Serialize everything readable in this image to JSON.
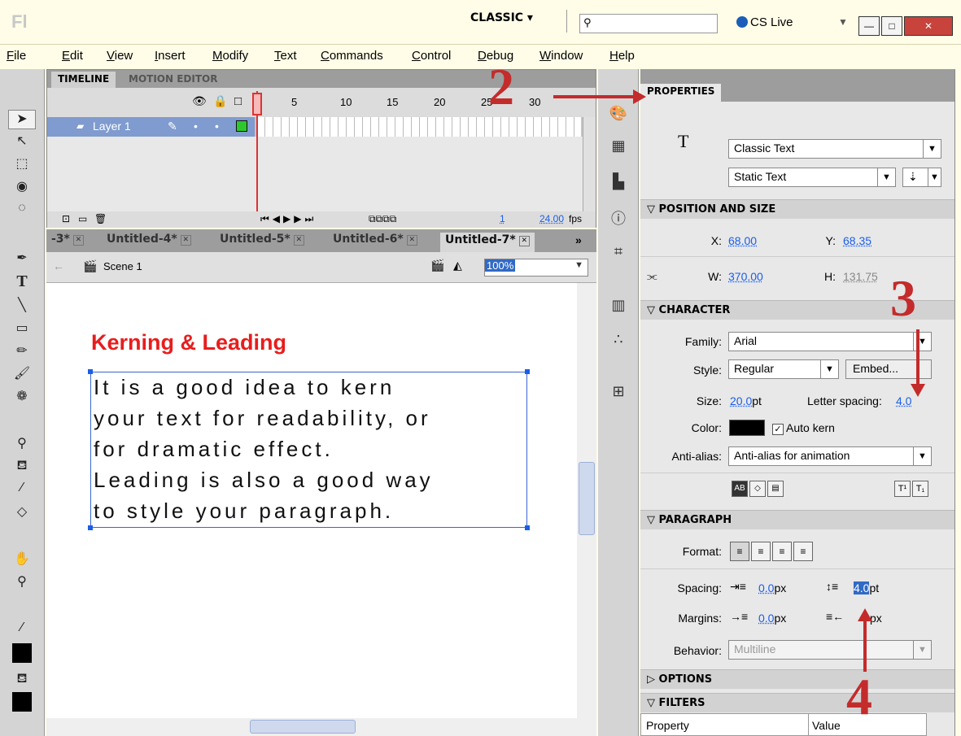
{
  "titlebar": {
    "app_logo": "Fl",
    "workspace": "CLASSIC",
    "search_icon": "search-icon",
    "cs_live": "CS Live"
  },
  "menu": [
    "File",
    "Edit",
    "View",
    "Insert",
    "Modify",
    "Text",
    "Commands",
    "Control",
    "Debug",
    "Window",
    "Help"
  ],
  "timeline": {
    "tabs": [
      "TIMELINE",
      "MOTION EDITOR"
    ],
    "frame_numbers": [
      "5",
      "10",
      "15",
      "20",
      "25",
      "30"
    ],
    "layer_name": "Layer 1",
    "current_frame": "1",
    "fps": "24.00",
    "fps_unit": "fps"
  },
  "doc_tabs": [
    "-3*",
    "Untitled-4*",
    "Untitled-5*",
    "Untitled-6*",
    "Untitled-7*"
  ],
  "scene": {
    "label": "Scene 1",
    "zoom": "100%"
  },
  "stage": {
    "title": "Kerning & Leading",
    "lines": [
      "It is a good idea to kern",
      "your text for readability, or",
      "for dramatic effect.",
      "Leading is also a good way",
      "to style your paragraph."
    ]
  },
  "properties": {
    "tab": "PROPERTIES",
    "text_type": "Classic Text",
    "text_kind": "Static Text",
    "position_section": "POSITION AND SIZE",
    "x_label": "X:",
    "x": "68.00",
    "y_label": "Y:",
    "y": "68.35",
    "w_label": "W:",
    "w": "370.00",
    "h_label": "H:",
    "h": "131.75",
    "character_section": "CHARACTER",
    "family_label": "Family:",
    "family": "Arial",
    "style_label": "Style:",
    "style": "Regular",
    "embed": "Embed...",
    "size_label": "Size:",
    "size": "20.0",
    "size_unit": "pt",
    "letter_spacing_label": "Letter spacing:",
    "letter_spacing": "4.0",
    "color_label": "Color:",
    "auto_kern": "Auto kern",
    "antialias_label": "Anti-alias:",
    "antialias": "Anti-alias for animation",
    "paragraph_section": "PARAGRAPH",
    "format_label": "Format:",
    "spacing_label": "Spacing:",
    "indent": "0.0",
    "indent_unit": "px",
    "line_spacing": "4.0",
    "line_spacing_unit": "pt",
    "margins_label": "Margins:",
    "margin_left": "0.0",
    "margin_left_unit": "px",
    "margin_right_unit": "px",
    "behavior_label": "Behavior:",
    "behavior": "Multiline",
    "options_section": "OPTIONS",
    "filters_section": "FILTERS",
    "table_property": "Property",
    "table_value": "Value"
  },
  "annotations": [
    "2",
    "3",
    "4"
  ],
  "colors": {
    "annotation": "#c42b2b",
    "stage_title": "#e81d1d",
    "selection": "#316ac5"
  }
}
